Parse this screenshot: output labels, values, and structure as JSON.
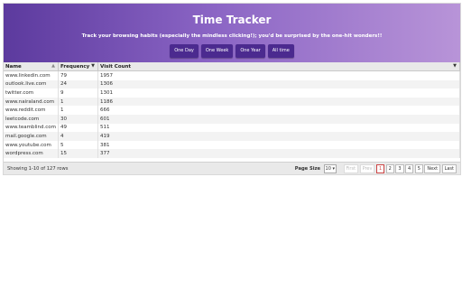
{
  "header": {
    "title": "Time Tracker",
    "subtitle": "Track your browsing habits (especially the mindless clicking!); you'd be surprised by the one-hit wonders!!",
    "buttons": [
      "One Day",
      "One Week",
      "One Year",
      "All time"
    ]
  },
  "table": {
    "columns": [
      "Name",
      "Frequency",
      "Visit Count"
    ],
    "rows": [
      [
        "www.linkedin.com",
        "79",
        "1957"
      ],
      [
        "outlook.live.com",
        "24",
        "1306"
      ],
      [
        "twitter.com",
        "9",
        "1301"
      ],
      [
        "www.nairaland.com",
        "1",
        "1186"
      ],
      [
        "www.reddit.com",
        "1",
        "666"
      ],
      [
        "leetcode.com",
        "30",
        "601"
      ],
      [
        "www.teamblind.com",
        "49",
        "511"
      ],
      [
        "mail.google.com",
        "4",
        "419"
      ],
      [
        "www.youtube.com",
        "5",
        "381"
      ],
      [
        "wordpress.com",
        "15",
        "377"
      ]
    ]
  },
  "footer": {
    "rows_info": "Showing 1-10 of 127 rows",
    "page_size_label": "Page Size",
    "page_size_value": "10",
    "first": "First",
    "prev": "Prev",
    "pages": [
      "1",
      "2",
      "3",
      "4",
      "5"
    ],
    "active_page": "1",
    "next": "Next",
    "last": "Last"
  }
}
